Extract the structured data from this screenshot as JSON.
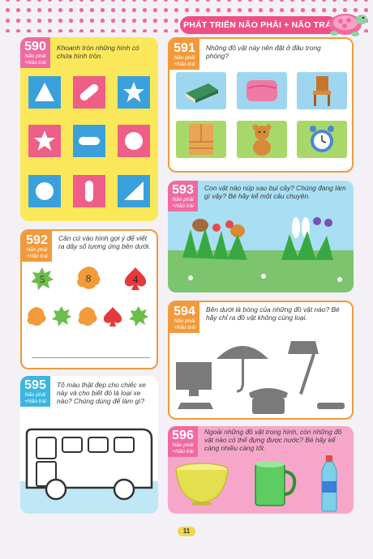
{
  "header": {
    "title": "PHÁT TRIỂN NÃO PHẢI + NÃO TRÁI"
  },
  "page_number": "11",
  "exercises": [
    {
      "number": "590",
      "tag_line1": "Não phải",
      "tag_line2": "+Não trái",
      "prompt": "Khoanh tròn những hình có chứa hình tròn."
    },
    {
      "number": "591",
      "tag_line1": "Não phải",
      "tag_line2": "+Não trái",
      "prompt": "Những đồ vật này nên đặt ở đâu trong phòng?"
    },
    {
      "number": "593",
      "tag_line1": "Não phải",
      "tag_line2": "+Não trái",
      "prompt": "Con vật nào núp sau bụi cây? Chúng đang làm gì vậy? Bé hãy kể một câu chuyện."
    },
    {
      "number": "592",
      "tag_line1": "Não phải",
      "tag_line2": "+Não trái",
      "prompt": "Căn cứ vào hình gợi ý để viết ra dãy số tương ứng bên dưới."
    },
    {
      "number": "594",
      "tag_line1": "Não phải",
      "tag_line2": "+Não trái",
      "prompt": "Bên dưới là bóng của những đồ vật nào? Bé hãy chỉ ra đồ vật không cùng loại."
    },
    {
      "number": "595",
      "tag_line1": "Não phải",
      "tag_line2": "+Não trái",
      "prompt": "Tô màu thật đẹp cho chiếc xe này và cho biết đó là loại xe nào? Chúng dùng để làm gì?"
    },
    {
      "number": "596",
      "tag_line1": "Não phải",
      "tag_line2": "+Não trái",
      "prompt": "Ngoài những đồ vật trong hình, còn những đồ vật nào có thể đựng được nước? Bé hãy kể càng nhiều càng tốt."
    }
  ],
  "hint_digits": [
    "5",
    "8",
    "4"
  ],
  "colors": {
    "pink": "#f06aa0",
    "orange": "#f29a3b",
    "yellow": "#fbe85a",
    "blue": "#3bb6e0",
    "tile_blue": "#3aa0dc",
    "tile_pink": "#ee5e86",
    "panel_596": "#f6a7c9"
  }
}
